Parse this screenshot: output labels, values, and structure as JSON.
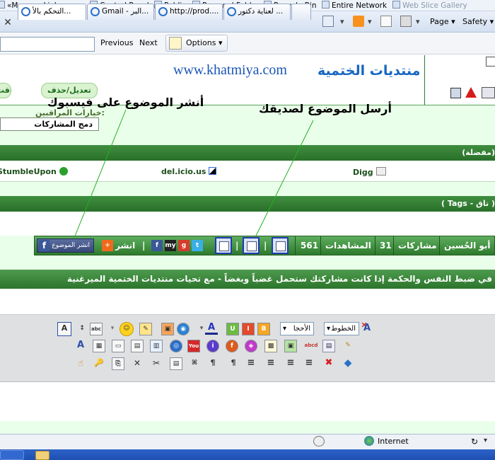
{
  "browser": {
    "favorites": [
      "«Manage Links»",
      "Control Panel",
      "Public",
      "Personal Folder",
      "Recycle Bin",
      "Entire Network",
      "Web Slice Gallery"
    ],
    "tabs": [
      "التحكم بالأ...",
      "Gmail - البر...",
      "http://prod....",
      "لعناية دكتور ..."
    ],
    "commands": {
      "page": "Page",
      "safety": "Safety"
    },
    "find": {
      "previous": "Previous",
      "next": "Next",
      "options": "Options",
      "input_value": ""
    },
    "status": {
      "zone": "Internet",
      "zoom_glyph": "↻"
    }
  },
  "header": {
    "url_text": "www.khatmiya.com",
    "site_name": "منتديات الختمية",
    "edit_delete": "تعديل/حذف",
    "quote": "إقت"
  },
  "moderation": {
    "label": "خيارات المراقبين:",
    "select_value": "دمج المشاركات"
  },
  "bookmarks": {
    "band_title": "(مفضلة)",
    "items": [
      "StumbleUpon",
      "del.icio.us",
      "Digg"
    ]
  },
  "tags": {
    "band_title": "( Tags - تاق )"
  },
  "stats": {
    "author": "أبو الحُسين",
    "posts_label": "مشاركات",
    "posts_value": "31",
    "views_label": "المشاهدات",
    "views_value": "561",
    "share_label": "انشر",
    "share_fb": "انشر الموضوع",
    "pipe": "|"
  },
  "marquee": "في ضبط النفس والحكمة إذا كانت مشاركتك ستحمل غضباً وبغضاً - مع تحيات منتديات الختمية الميرغنية",
  "editor": {
    "font_select": "الخطوط",
    "size_select": "الأحجا",
    "row1": [
      "abc",
      "☺",
      "✎",
      "▣",
      "◉",
      "A",
      "U",
      "I",
      "B"
    ],
    "row2": [
      "A",
      "▦",
      "▭",
      "▤",
      "▥",
      "◎",
      "You",
      "i",
      "f",
      "◈",
      "▩",
      "▣",
      "abcd",
      "▤",
      "✎"
    ],
    "row3": [
      "☝",
      "🔑",
      "⎘",
      "✕",
      "✂",
      "▤",
      "⌘",
      "¶",
      "≡",
      "≡",
      "≡",
      "≡",
      "✖",
      "◆"
    ]
  },
  "annotations": {
    "facebook": "أنشر الموضوع على فيسبوك",
    "friend": "أرسل الموضوع لصديقك"
  },
  "colors": {
    "forum_green": "#2d7a2d",
    "light_green": "#eaffea",
    "link_blue": "#1a56b4"
  }
}
